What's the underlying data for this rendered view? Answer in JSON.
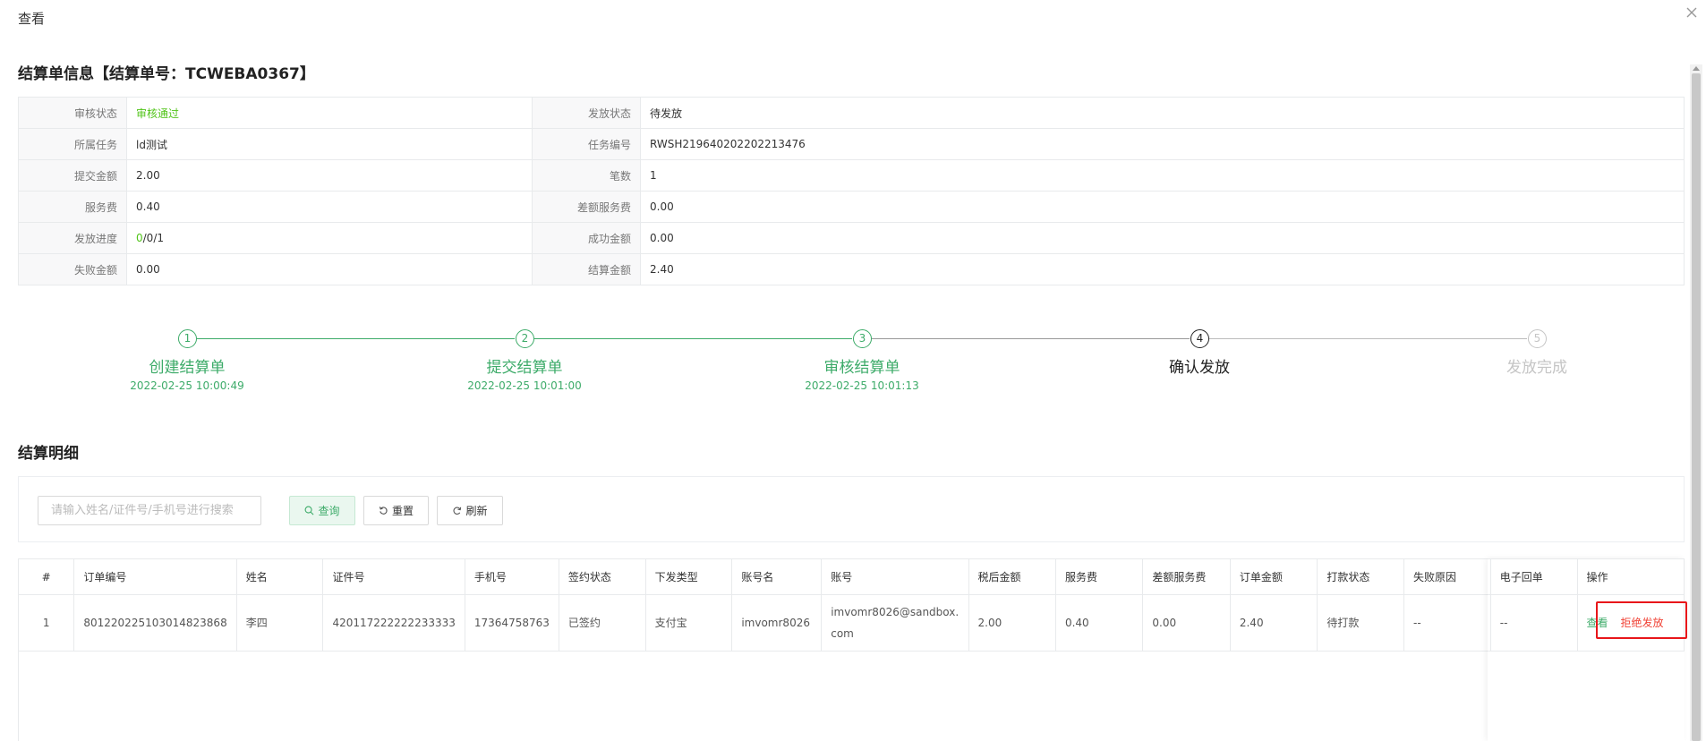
{
  "dialog": {
    "title": "查看"
  },
  "settlement": {
    "title": "结算单信息【结算单号：TCWEBA0367】",
    "rows": [
      {
        "label1": "审核状态",
        "value1": "审核通过",
        "label2": "发放状态",
        "value2": "待发放"
      },
      {
        "label1": "所属任务",
        "value1": "ld测试",
        "label2": "任务编号",
        "value2": "RWSH219640202202213476"
      },
      {
        "label1": "提交金额",
        "value1": "2.00",
        "label2": "笔数",
        "value2": "1"
      },
      {
        "label1": "服务费",
        "value1": "0.40",
        "label2": "差额服务费",
        "value2": "0.00"
      },
      {
        "label1": "发放进度",
        "value1_done": "0",
        "value1_rest": "/0/1",
        "label2": "成功金额",
        "value2": "0.00"
      },
      {
        "label1": "失败金额",
        "value1": "0.00",
        "label2": "结算金额",
        "value2": "2.40"
      }
    ]
  },
  "steps": [
    {
      "num": "1",
      "title": "创建结算单",
      "time": "2022-02-25 10:00:49",
      "state": "done"
    },
    {
      "num": "2",
      "title": "提交结算单",
      "time": "2022-02-25 10:01:00",
      "state": "done"
    },
    {
      "num": "3",
      "title": "审核结算单",
      "time": "2022-02-25 10:01:13",
      "state": "done"
    },
    {
      "num": "4",
      "title": "确认发放",
      "time": "",
      "state": "current"
    },
    {
      "num": "5",
      "title": "发放完成",
      "time": "",
      "state": "pending"
    }
  ],
  "detail": {
    "title": "结算明细",
    "search_placeholder": "请输入姓名/证件号/手机号进行搜索",
    "query_label": "查询",
    "reset_label": "重置",
    "refresh_label": "刷新",
    "columns": [
      "#",
      "订单编号",
      "姓名",
      "证件号",
      "手机号",
      "签约状态",
      "下发类型",
      "账号名",
      "账号",
      "税后金额",
      "服务费",
      "差额服务费",
      "订单金额",
      "打款状态",
      "失败原因",
      "电子回单",
      "操作"
    ],
    "rows": [
      {
        "idx": "1",
        "order_no": "801220225103014823868",
        "name": "李四",
        "id_no": "420117222222233333",
        "phone": "17364758763",
        "sign_status": "已签约",
        "pay_type": "支付宝",
        "account_name": "imvomr8026",
        "account": "imvomr8026@sandbox.com",
        "after_tax": "2.00",
        "service_fee": "0.40",
        "diff_fee": "0.00",
        "order_amount": "2.40",
        "pay_status": "待打款",
        "fail_reason": "--",
        "receipt": "--",
        "op_view": "查看",
        "op_reject": "拒绝发放"
      }
    ]
  },
  "colors": {
    "accent": "#3dab69",
    "reject": "#f04134",
    "highlight": "#e8161a"
  }
}
